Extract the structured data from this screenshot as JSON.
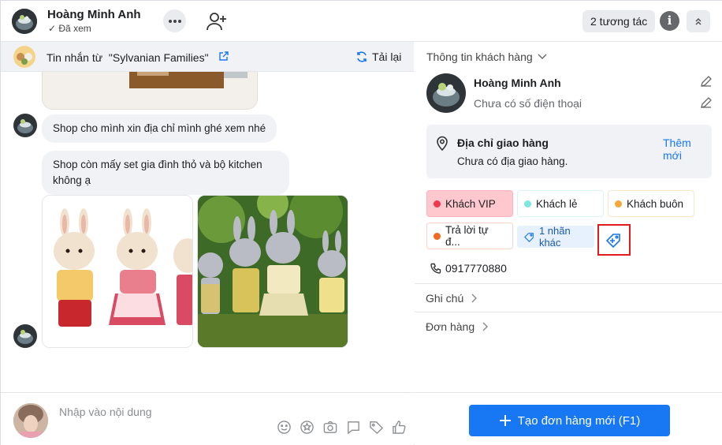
{
  "header": {
    "contact_name": "Hoàng Minh Anh",
    "seen_label": "Đã xem",
    "interactions_label": "2 tương tác"
  },
  "chat": {
    "source_prefix": "Tin nhắn từ",
    "source_page": "\"Sylvanian Families\"",
    "reload_label": "Tải lại",
    "messages": [
      "Shop cho mình xin địa chỉ mình ghé xem nhé",
      "Shop còn mấy set gia đình thỏ và bộ kitchen không ạ"
    ],
    "input_placeholder": "Nhập vào nội dung"
  },
  "panel": {
    "section_title": "Thông tin khách hàng",
    "customer_name": "Hoàng Minh Anh",
    "phone_placeholder": "Chưa có số điện thoại",
    "address": {
      "title": "Địa chỉ giao hàng",
      "empty_text": "Chưa có địa giao hàng.",
      "add_label": "Thêm mới"
    },
    "tags": [
      {
        "label": "Khách VIP",
        "color": "#f0384e"
      },
      {
        "label": "Khách lẻ",
        "color": "#7be8e0"
      },
      {
        "label": "Khách buôn",
        "color": "#f5a83a"
      },
      {
        "label": "Trả lời tự đ...",
        "color": "#f26a21"
      }
    ],
    "more_tags_label": "1 nhãn khác",
    "phone": "0917770880",
    "notes_label": "Ghi chú",
    "orders_label": "Đơn hàng",
    "create_order_label": "Tạo đơn hàng mới (F1)"
  },
  "colors": {
    "accent": "#1877f2",
    "highlight_border": "#e31b1b"
  }
}
